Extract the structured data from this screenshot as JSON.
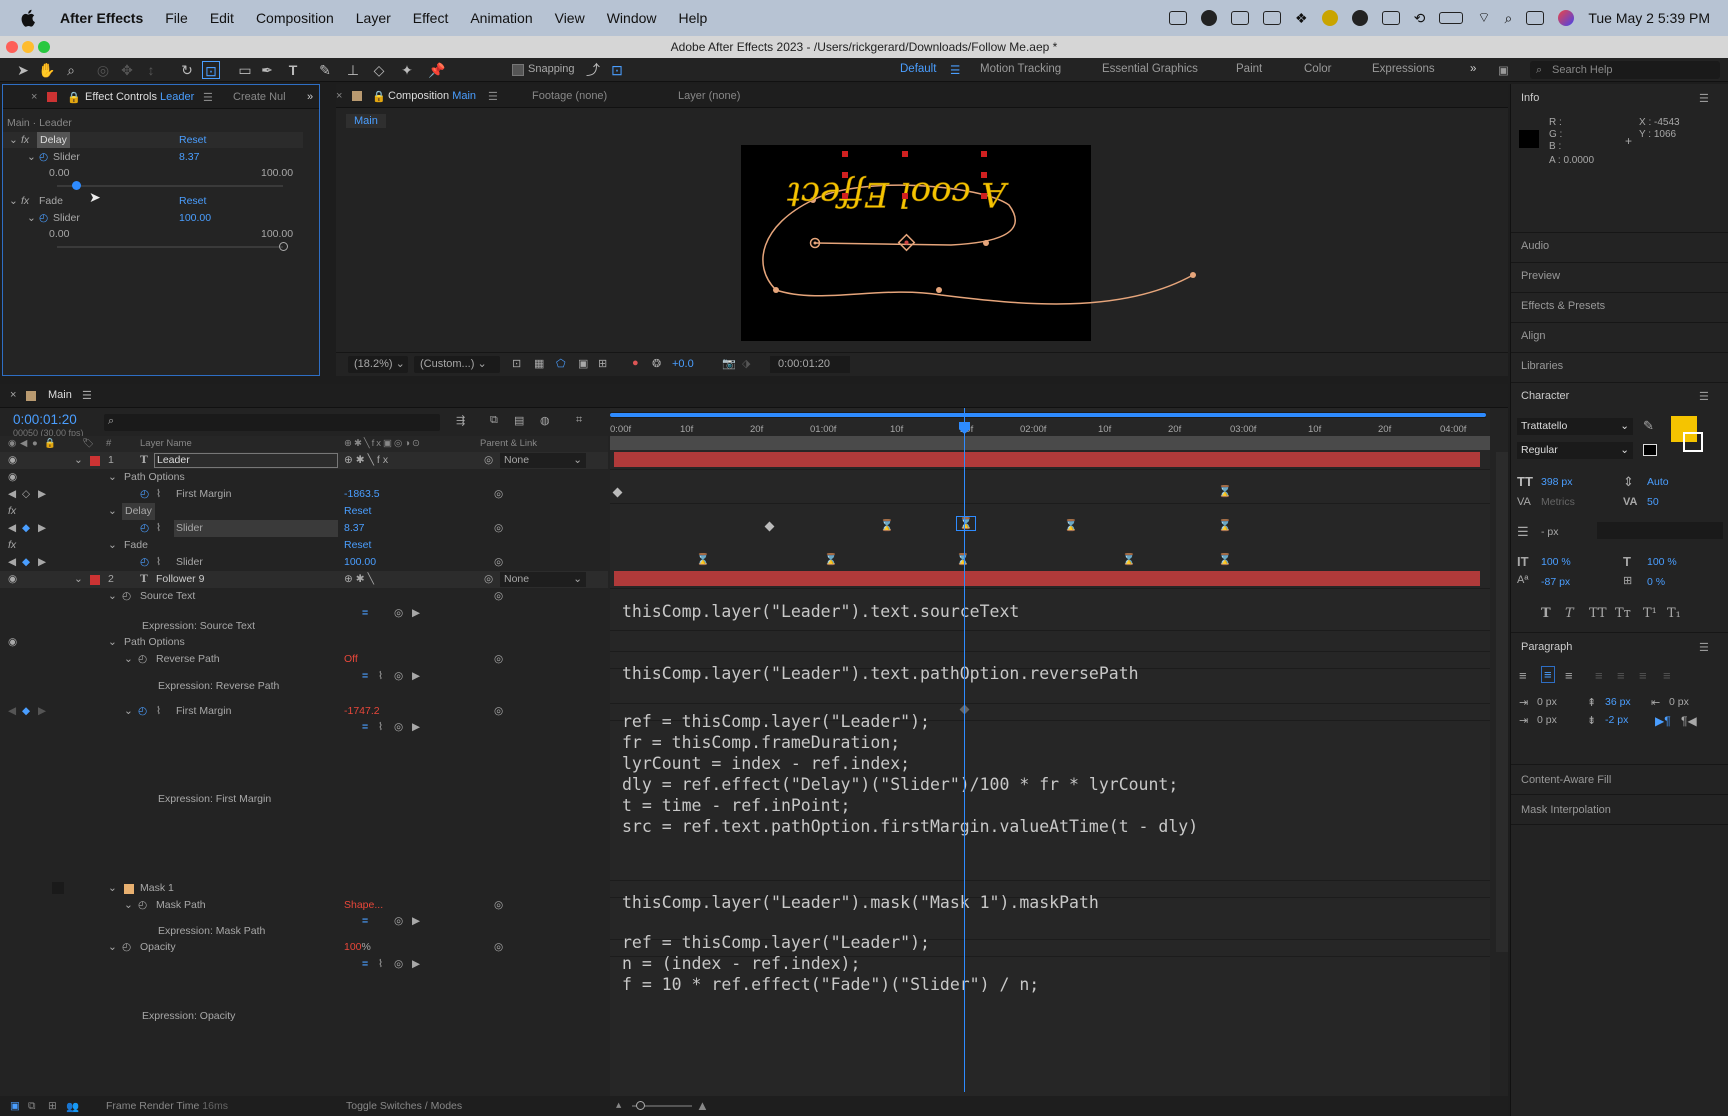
{
  "menubar": {
    "app": "After Effects",
    "items": [
      "File",
      "Edit",
      "Composition",
      "Layer",
      "Effect",
      "Animation",
      "View",
      "Window",
      "Help"
    ],
    "datetime": "Tue May 2  5:39 PM"
  },
  "window_title": "Adobe After Effects 2023 - /Users/rickgerard/Downloads/Follow Me.aep *",
  "toolbar": {
    "snapping": "Snapping",
    "workspaces": [
      "Default",
      "Motion Tracking",
      "Essential Graphics",
      "Paint",
      "Color",
      "Expressions"
    ],
    "active_workspace": "Default",
    "search_placeholder": "Search Help"
  },
  "effect_controls": {
    "tab_label": "Effect Controls",
    "tab_layer": "Leader",
    "tab2": "Create Nul",
    "breadcrumb": "Main · Leader",
    "effects": [
      {
        "name": "Delay",
        "reset": "Reset",
        "prop": "Slider",
        "value": "8.37",
        "min": "0.00",
        "max": "100.00",
        "fraction": 0.0837
      },
      {
        "name": "Fade",
        "reset": "Reset",
        "prop": "Slider",
        "value": "100.00",
        "min": "0.00",
        "max": "100.00",
        "fraction": 1.0
      }
    ]
  },
  "composition": {
    "tab_label": "Composition",
    "tab_comp": "Main",
    "footage_tab": "Footage (none)",
    "layer_tab": "Layer (none)",
    "subtab": "Main",
    "canvas_text": "A cool Effect",
    "zoom": "(18.2%)",
    "resolution": "(Custom...)",
    "exposure": "+0.0",
    "timecode": "0:00:01:20"
  },
  "info_panel": {
    "title": "Info",
    "r": "R :",
    "g": "G :",
    "b": "B :",
    "a": "A :  0.0000",
    "x": "X : -4543",
    "y": "Y : 1066"
  },
  "right_panels": [
    "Audio",
    "Preview",
    "Effects & Presets",
    "Align",
    "Libraries"
  ],
  "character": {
    "title": "Character",
    "font": "Trattatello",
    "style": "Regular",
    "size": "398 px",
    "leading": "Auto",
    "kerning": "Metrics",
    "tracking": "50",
    "stroke": "- px",
    "vscale": "100 %",
    "hscale": "100 %",
    "baseline": "-87 px",
    "tsume": "0 %",
    "fill_color": "#f5c400",
    "style_buttons": [
      "T",
      "T",
      "TT",
      "Tт",
      "T¹",
      "T₁"
    ]
  },
  "paragraph": {
    "title": "Paragraph",
    "indent_left": "0 px",
    "space_before": "36 px",
    "indent_right": "0 px",
    "indent_first": "0 px",
    "space_after": "-2 px"
  },
  "extra_panels": [
    "Content-Aware Fill",
    "Mask Interpolation"
  ],
  "timeline": {
    "tab": "Main",
    "timecode": "0:00:01:20",
    "frame_info": "00050 (30.00 fps)",
    "col_layer_name": "Layer Name",
    "col_parent": "Parent & Link",
    "ruler": [
      "0:00f",
      "10f",
      "20f",
      "01:00f",
      "10f",
      "20f",
      "02:00f",
      "10f",
      "20f",
      "03:00f",
      "10f",
      "20f",
      "04:00f"
    ],
    "rows": {
      "l1_num": "1",
      "l1_name": "Leader",
      "l1_parent": "None",
      "path_options": "Path Options",
      "first_margin": "First Margin",
      "first_margin_val": "-1863.5",
      "delay": "Delay",
      "delay_reset": "Reset",
      "slider": "Slider",
      "delay_val": "8.37",
      "fade": "Fade",
      "fade_reset": "Reset",
      "fade_val": "100.00",
      "l2_num": "2",
      "l2_name": "Follower 9",
      "l2_parent": "None",
      "source_text": "Source Text",
      "expr_source_text": "Expression: Source Text",
      "path_options2": "Path Options",
      "reverse_path": "Reverse Path",
      "reverse_path_val": "Off",
      "expr_reverse_path": "Expression: Reverse Path",
      "first_margin2": "First Margin",
      "first_margin2_val": "-1747.2",
      "expr_first_margin": "Expression: First Margin",
      "mask1": "Mask 1",
      "mask_path": "Mask Path",
      "mask_path_val": "Shape...",
      "expr_mask_path": "Expression: Mask Path",
      "opacity": "Opacity",
      "opacity_val": "100",
      "opacity_unit": "%",
      "expr_opacity": "Expression: Opacity"
    },
    "code": {
      "source_text": "thisComp.layer(\"Leader\").text.sourceText",
      "reverse_path": "thisComp.layer(\"Leader\").text.pathOption.reversePath",
      "first_margin": "ref = thisComp.layer(\"Leader\");\nfr = thisComp.frameDuration;\nlyrCount = index - ref.index;\ndly = ref.effect(\"Delay\")(\"Slider\")/100 * fr * lyrCount;\nt = time - ref.inPoint;\nsrc = ref.text.pathOption.firstMargin.valueAtTime(t - dly)",
      "mask_path": "thisComp.layer(\"Leader\").mask(\"Mask 1\").maskPath",
      "opacity": "ref = thisComp.layer(\"Leader\");\nn = (index - ref.index);\nf = 10 * ref.effect(\"Fade\")(\"Slider\") / n;"
    },
    "status": {
      "render": "Frame Render Time",
      "render_val": "16ms",
      "toggle": "Toggle Switches / Modes"
    }
  }
}
